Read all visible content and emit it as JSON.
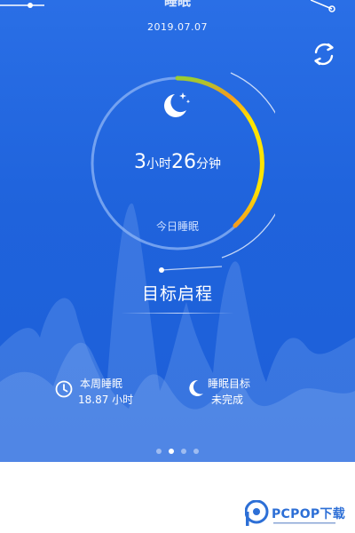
{
  "header": {
    "title": "睡眠",
    "date": "2019.07.07"
  },
  "sleep": {
    "hours": "3",
    "hours_unit": "小时",
    "minutes": "26",
    "minutes_unit": "分钟",
    "today_label": "今日睡眠",
    "ring_fill_fraction": 0.28
  },
  "goal": {
    "button_label": "目标启程"
  },
  "stats": {
    "week_title": "本周睡眠",
    "week_value": "18.87 小时",
    "goal_title": "睡眠目标",
    "goal_status": "未完成"
  },
  "pager": {
    "count": 4,
    "active_index": 1
  },
  "watermark": {
    "brand": "PCPOP下载"
  },
  "colors": {
    "bg_top": "#2a6fe6",
    "bg_bottom": "#1d5fd8",
    "ring_track": "#8fb6f5",
    "ring_green": "#9acd32",
    "ring_orange": "#f39c1f",
    "ring_yellow": "#ffe400",
    "brand_blue": "#2d6fd6"
  },
  "icons": {
    "refresh": "refresh-icon",
    "moon": "moon-stars-icon",
    "clock": "clock-icon",
    "goal_moon": "crescent-moon-icon"
  }
}
